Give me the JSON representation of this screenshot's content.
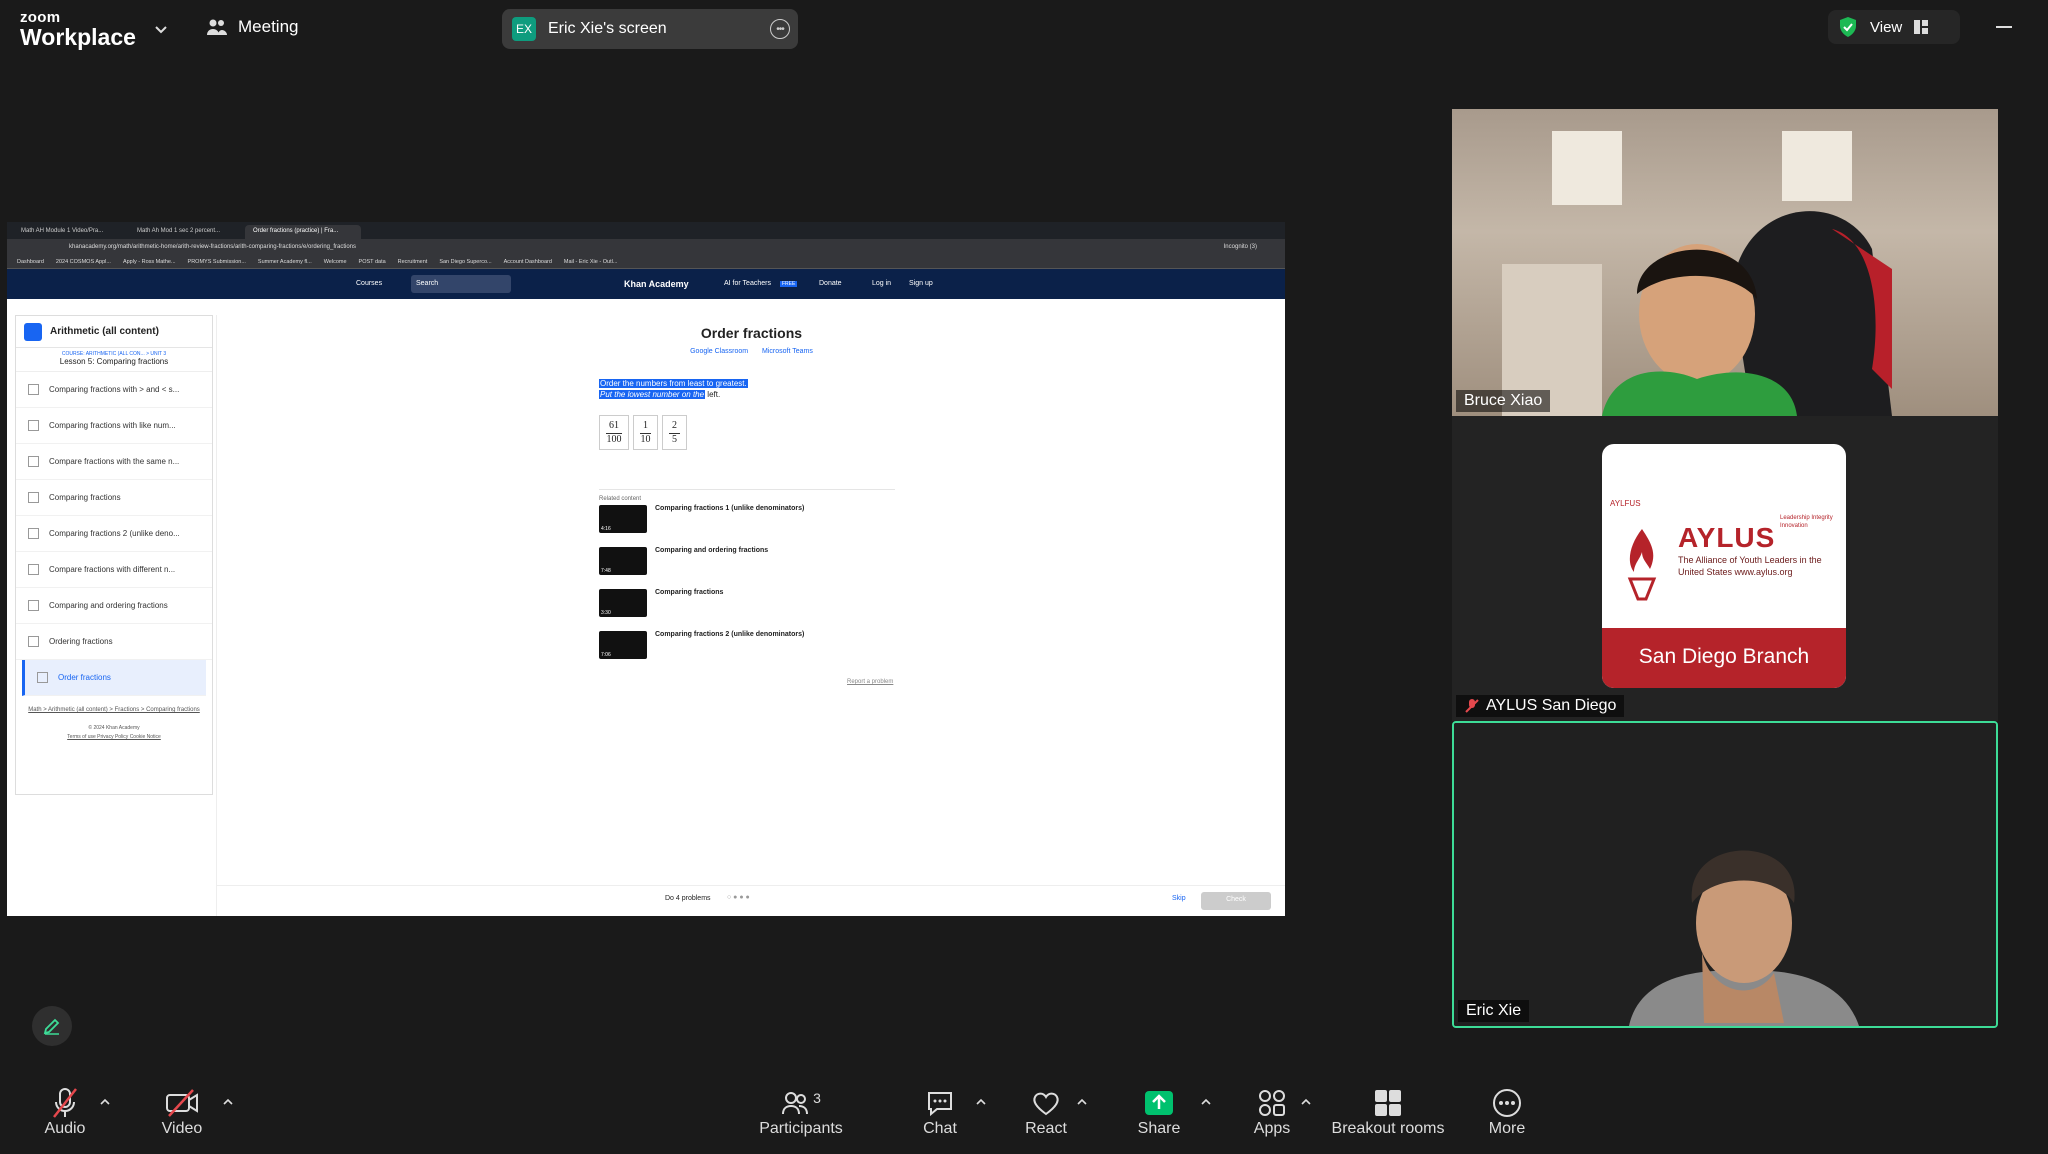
{
  "topbar": {
    "logo_line1": "zoom",
    "logo_line2": "Workplace",
    "meeting_label": "Meeting",
    "screen_badge": "EX",
    "screen_label": "Eric Xie's screen",
    "view_label": "View"
  },
  "browser": {
    "tabs": [
      "Math AH Module 1 Video/Pra...",
      "Math Ah Mod 1 sec 2 percent...",
      "Order fractions (practice) | Fra..."
    ],
    "url": "khanacademy.org/math/arithmetic-home/arith-review-fractions/arith-comparing-fractions/e/ordering_fractions",
    "incognito": "Incognito (3)",
    "bookmarks": [
      "Dashboard",
      "2024 COSMOS Appl...",
      "Apply - Ross Mathe...",
      "PROMYS Submission...",
      "Summer Academy fl...",
      "Welcome",
      "POST data",
      "Recruitment",
      "San Diego Supercо...",
      "Account Dashboard",
      "Mail - Eric Xie - Outl..."
    ]
  },
  "khan_nav": {
    "courses": "Courses",
    "search": "Search",
    "brand": "Khan Academy",
    "ai": "AI for Teachers",
    "free": "FREE",
    "donate": "Donate",
    "login": "Log in",
    "signup": "Sign up"
  },
  "sidebar": {
    "course": "Arithmetic (all content)",
    "unit_tag": "COURSE: ARITHMETIC (ALL CON...  > UNIT 3",
    "lesson": "Lesson 5: Comparing fractions",
    "items": [
      "Comparing fractions with > and < s...",
      "Comparing fractions with like num...",
      "Compare fractions with the same n...",
      "Comparing fractions",
      "Comparing fractions 2 (unlike deno...",
      "Compare fractions with different n...",
      "Comparing and ordering fractions",
      "Ordering fractions",
      "Order fractions"
    ],
    "breadcrumb": "Math > Arithmetic (all content) > Fractions > Comparing fractions",
    "copyright": "© 2024 Khan Academy",
    "legal": "Terms of use    Privacy Policy    Cookie Notice"
  },
  "exercise": {
    "title": "Order fractions",
    "link1": "Google Classroom",
    "link2": "Microsoft Teams",
    "q1": "Order the numbers from least to greatest.",
    "q2a": "Put the lowest number on the",
    "q2b": " left.",
    "fractions": [
      {
        "num": "61",
        "den": "100"
      },
      {
        "num": "1",
        "den": "10"
      },
      {
        "num": "2",
        "den": "5"
      }
    ],
    "related_label": "Related content",
    "related": [
      {
        "title": "Comparing fractions 1 (unlike denominators)",
        "dur": "4:16"
      },
      {
        "title": "Comparing and ordering fractions",
        "dur": "7:48"
      },
      {
        "title": "Comparing fractions",
        "dur": "3:30"
      },
      {
        "title": "Comparing fractions 2 (unlike denominators)",
        "dur": "7:06"
      }
    ],
    "report": "Report a problem",
    "do_problems": "Do 4 problems",
    "skip": "Skip",
    "check": "Check"
  },
  "participants": {
    "p1": "Bruce Xiao",
    "p2": "AYLUS San Diego",
    "p3": "Eric Xie"
  },
  "aylus_logo": {
    "small": "AYLFUS",
    "big": "AYLUS",
    "sub": "The Alliance of Youth Leaders in the United States www.aylus.org",
    "side": "Leadership Integrity Innovation",
    "band": "San Diego Branch"
  },
  "toolbar": {
    "audio": "Audio",
    "video": "Video",
    "participants": "Participants",
    "participant_count": "3",
    "chat": "Chat",
    "react": "React",
    "share": "Share",
    "apps": "Apps",
    "breakout": "Breakout rooms",
    "more": "More"
  },
  "colors": {
    "share_green": "#00c16e",
    "active_speaker": "#3ddc97",
    "khan_navy": "#0b2149",
    "khan_blue": "#1865f2",
    "aylus_red": "#b5232a"
  }
}
